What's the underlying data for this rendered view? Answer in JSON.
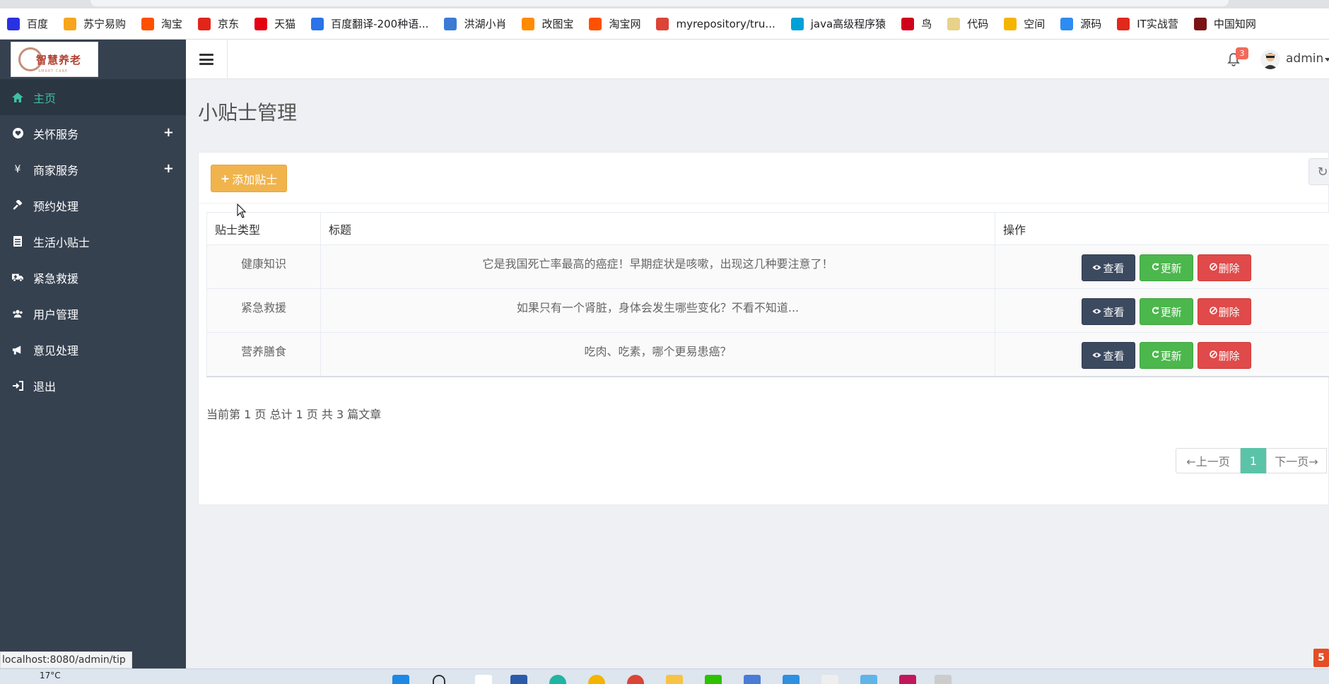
{
  "bookmarks": [
    {
      "label": "百度",
      "icon": "baidu-paw-icon",
      "color": "#2932e1"
    },
    {
      "label": "苏宁易购",
      "icon": "suning-icon",
      "color": "#f7a51c"
    },
    {
      "label": "淘宝",
      "icon": "taobao-icon",
      "color": "#ff5000"
    },
    {
      "label": "京东",
      "icon": "jd-icon",
      "color": "#e1251b"
    },
    {
      "label": "天猫",
      "icon": "tmall-icon",
      "color": "#e40012"
    },
    {
      "label": "百度翻译-200种语...",
      "icon": "translate-icon",
      "color": "#2a73e8"
    },
    {
      "label": "洪湖小肖",
      "icon": "bird-icon",
      "color": "#3a7bd5"
    },
    {
      "label": "改图宝",
      "icon": "gaitubao-icon",
      "color": "#ff8c00"
    },
    {
      "label": "淘宝网",
      "icon": "taobao-net-icon",
      "color": "#ff5000"
    },
    {
      "label": "myrepository/tru...",
      "icon": "chrome-icon",
      "color": "#db4437"
    },
    {
      "label": "java高级程序猿",
      "icon": "bilibili-icon",
      "color": "#00a1d6"
    },
    {
      "label": "鸟",
      "icon": "swallow-icon",
      "color": "#d0021b"
    },
    {
      "label": "代码",
      "icon": "code-icon",
      "color": "#e8d28a"
    },
    {
      "label": "空间",
      "icon": "qzone-icon",
      "color": "#f5b400"
    },
    {
      "label": "源码",
      "icon": "fish-icon",
      "color": "#2d8cf0"
    },
    {
      "label": "IT实战营",
      "icon": "it-camp-icon",
      "color": "#e0281b"
    },
    {
      "label": "中国知网",
      "icon": "cnki-icon",
      "color": "#7a1414"
    }
  ],
  "logo": {
    "text": "智慧养老",
    "sub": "SMART CARE"
  },
  "nav": {
    "home": "主页",
    "care": "关怀服务",
    "merchant": "商家服务",
    "booking": "预约处理",
    "tips": "生活小贴士",
    "rescue": "紧急救援",
    "users": "用户管理",
    "feedback": "意见处理",
    "logout": "退出",
    "plus": "+"
  },
  "header": {
    "notifications": "3",
    "user": "admin"
  },
  "page": {
    "title": "小贴士管理"
  },
  "toolbar": {
    "add_label": "添加贴士",
    "add_icon": "+",
    "refresh_icon": "↻"
  },
  "table": {
    "headers": {
      "type": "贴士类型",
      "title": "标题",
      "ops": "操作"
    },
    "rows": [
      {
        "type": "健康知识",
        "title": "它是我国死亡率最高的癌症！早期症状是咳嗽，出现这几种要注意了！"
      },
      {
        "type": "紧急救援",
        "title": "如果只有一个肾脏，身体会发生哪些变化？不看不知道..."
      },
      {
        "type": "营养膳食",
        "title": "吃肉、吃素，哪个更易患癌？"
      }
    ],
    "actions": {
      "view": "查看",
      "update": "更新",
      "delete": "删除"
    }
  },
  "pagination": {
    "info": "当前第 1 页 总计 1 页 共 3 篇文章",
    "prev": "←上一页",
    "current": "1",
    "next": "下一页→"
  },
  "status_url": "localhost:8080/admin/tip",
  "weather": "17°C",
  "colors": {
    "sidebar": "#364150",
    "active_text": "#3fbfa4",
    "add_button": "#f1b44c",
    "view_button": "#3c4a60",
    "update_button": "#4cb74d",
    "delete_button": "#e04a4a",
    "pager_active": "#5bc4a8"
  }
}
